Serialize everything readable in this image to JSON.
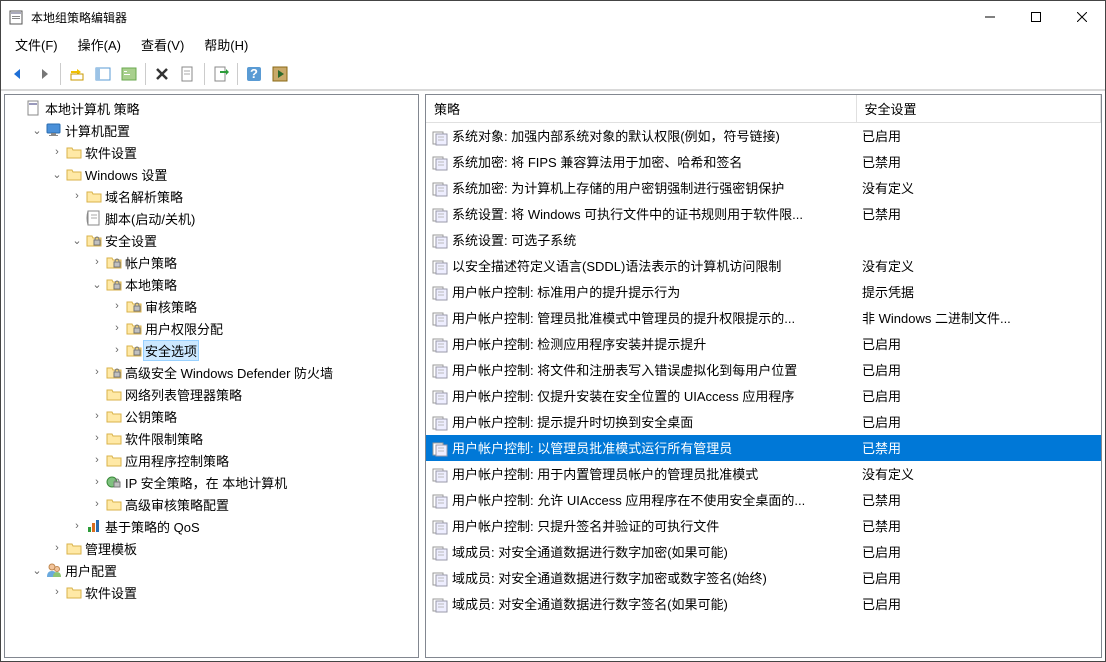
{
  "window": {
    "title": "本地组策略编辑器"
  },
  "menu": {
    "file": "文件(F)",
    "action": "操作(A)",
    "view": "查看(V)",
    "help": "帮助(H)"
  },
  "columns": {
    "policy": "策略",
    "setting": "安全设置"
  },
  "tree": [
    {
      "depth": 0,
      "tw": "",
      "ico": "doc",
      "label": "本地计算机 策略"
    },
    {
      "depth": 1,
      "tw": "open",
      "ico": "comp",
      "label": "计算机配置"
    },
    {
      "depth": 2,
      "tw": "closed",
      "ico": "fold",
      "label": "软件设置"
    },
    {
      "depth": 2,
      "tw": "open",
      "ico": "fold",
      "label": "Windows 设置"
    },
    {
      "depth": 3,
      "tw": "closed",
      "ico": "fold",
      "label": "域名解析策略"
    },
    {
      "depth": 3,
      "tw": "",
      "ico": "script",
      "label": "脚本(启动/关机)"
    },
    {
      "depth": 3,
      "tw": "open",
      "ico": "sec",
      "label": "安全设置"
    },
    {
      "depth": 4,
      "tw": "closed",
      "ico": "sec",
      "label": "帐户策略"
    },
    {
      "depth": 4,
      "tw": "open",
      "ico": "sec",
      "label": "本地策略"
    },
    {
      "depth": 5,
      "tw": "closed",
      "ico": "sec",
      "label": "审核策略"
    },
    {
      "depth": 5,
      "tw": "closed",
      "ico": "sec",
      "label": "用户权限分配"
    },
    {
      "depth": 5,
      "tw": "closed",
      "ico": "sec",
      "label": "安全选项",
      "selected": true
    },
    {
      "depth": 4,
      "tw": "closed",
      "ico": "sec",
      "label": "高级安全 Windows Defender 防火墙"
    },
    {
      "depth": 4,
      "tw": "",
      "ico": "fold",
      "label": "网络列表管理器策略"
    },
    {
      "depth": 4,
      "tw": "closed",
      "ico": "fold",
      "label": "公钥策略"
    },
    {
      "depth": 4,
      "tw": "closed",
      "ico": "fold",
      "label": "软件限制策略"
    },
    {
      "depth": 4,
      "tw": "closed",
      "ico": "fold",
      "label": "应用程序控制策略"
    },
    {
      "depth": 4,
      "tw": "closed",
      "ico": "ipsec",
      "label": "IP 安全策略，在 本地计算机"
    },
    {
      "depth": 4,
      "tw": "closed",
      "ico": "fold",
      "label": "高级审核策略配置"
    },
    {
      "depth": 3,
      "tw": "closed",
      "ico": "qos",
      "label": "基于策略的 QoS"
    },
    {
      "depth": 2,
      "tw": "closed",
      "ico": "fold",
      "label": "管理模板"
    },
    {
      "depth": 1,
      "tw": "open",
      "ico": "user",
      "label": "用户配置"
    },
    {
      "depth": 2,
      "tw": "closed",
      "ico": "fold",
      "label": "软件设置"
    }
  ],
  "policies": [
    {
      "name": "系统对象: 加强内部系统对象的默认权限(例如，符号链接)",
      "value": "已启用"
    },
    {
      "name": "系统加密: 将 FIPS 兼容算法用于加密、哈希和签名",
      "value": "已禁用"
    },
    {
      "name": "系统加密: 为计算机上存储的用户密钥强制进行强密钥保护",
      "value": "没有定义"
    },
    {
      "name": "系统设置: 将 Windows 可执行文件中的证书规则用于软件限...",
      "value": "已禁用"
    },
    {
      "name": "系统设置: 可选子系统",
      "value": ""
    },
    {
      "name": "以安全描述符定义语言(SDDL)语法表示的计算机访问限制",
      "value": "没有定义"
    },
    {
      "name": "用户帐户控制: 标准用户的提升提示行为",
      "value": "提示凭据"
    },
    {
      "name": "用户帐户控制: 管理员批准模式中管理员的提升权限提示的...",
      "value": "非 Windows 二进制文件..."
    },
    {
      "name": "用户帐户控制: 检测应用程序安装并提示提升",
      "value": "已启用"
    },
    {
      "name": "用户帐户控制: 将文件和注册表写入错误虚拟化到每用户位置",
      "value": "已启用"
    },
    {
      "name": "用户帐户控制: 仅提升安装在安全位置的 UIAccess 应用程序",
      "value": "已启用"
    },
    {
      "name": "用户帐户控制: 提示提升时切换到安全桌面",
      "value": "已启用"
    },
    {
      "name": "用户帐户控制: 以管理员批准模式运行所有管理员",
      "value": "已禁用",
      "selected": true
    },
    {
      "name": "用户帐户控制: 用于内置管理员帐户的管理员批准模式",
      "value": "没有定义"
    },
    {
      "name": "用户帐户控制: 允许 UIAccess 应用程序在不使用安全桌面的...",
      "value": "已禁用"
    },
    {
      "name": "用户帐户控制: 只提升签名并验证的可执行文件",
      "value": "已禁用"
    },
    {
      "name": "域成员: 对安全通道数据进行数字加密(如果可能)",
      "value": "已启用"
    },
    {
      "name": "域成员: 对安全通道数据进行数字加密或数字签名(始终)",
      "value": "已启用"
    },
    {
      "name": "域成员: 对安全通道数据进行数字签名(如果可能)",
      "value": "已启用"
    }
  ]
}
